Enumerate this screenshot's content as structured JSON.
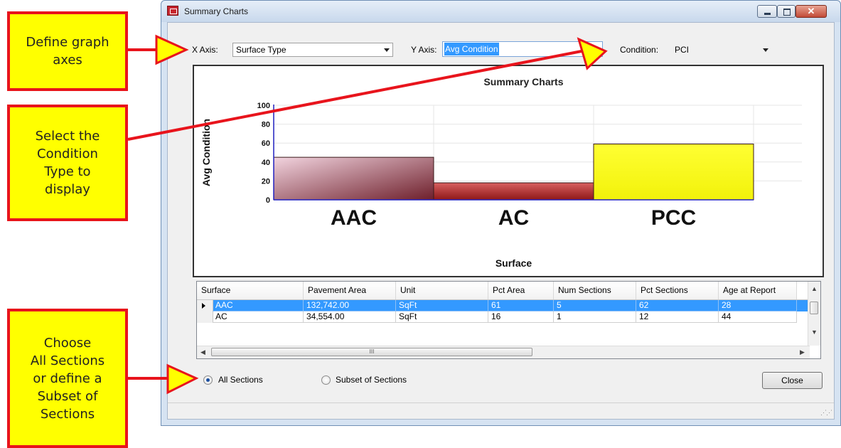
{
  "callouts": {
    "axes": "Define graph\naxes",
    "condition": "Select the\nCondition\nType to\ndisplay",
    "sections": "Choose\nAll Sections\nor define a\nSubset of\nSections"
  },
  "window": {
    "title": "Summary Charts",
    "close_glyph": "✕"
  },
  "controls": {
    "x_axis_label": "X Axis:",
    "x_axis_value": "Surface Type",
    "y_axis_label": "Y Axis:",
    "y_axis_value": "Avg Condition",
    "condition_label": "Condition:",
    "condition_value": "PCI"
  },
  "chart_data": {
    "type": "bar",
    "title": "Summary Charts",
    "xlabel": "Surface",
    "ylabel": "Avg Condition",
    "categories": [
      "AAC",
      "AC",
      "PCC"
    ],
    "values": [
      45,
      18,
      59
    ],
    "ylim": [
      0,
      100
    ],
    "yticks": [
      0,
      20,
      40,
      60,
      80,
      100
    ],
    "colors": [
      "#6e1f2b",
      "#8e1717",
      "#ffff33"
    ],
    "grid": true
  },
  "grid": {
    "columns": [
      "Surface",
      "Pavement Area",
      "Unit",
      "Pct Area",
      "Num Sections",
      "Pct Sections",
      "Age at Report"
    ],
    "rows": [
      [
        "AAC",
        "132,742.00",
        "SqFt",
        "61",
        "5",
        "62",
        "28"
      ],
      [
        "AC",
        "34,554.00",
        "SqFt",
        "16",
        "1",
        "12",
        "44"
      ]
    ],
    "selected_row": 0,
    "hscroll_grip": "III"
  },
  "bottom": {
    "all_sections": "All Sections",
    "subset_sections": "Subset of Sections",
    "close": "Close"
  }
}
